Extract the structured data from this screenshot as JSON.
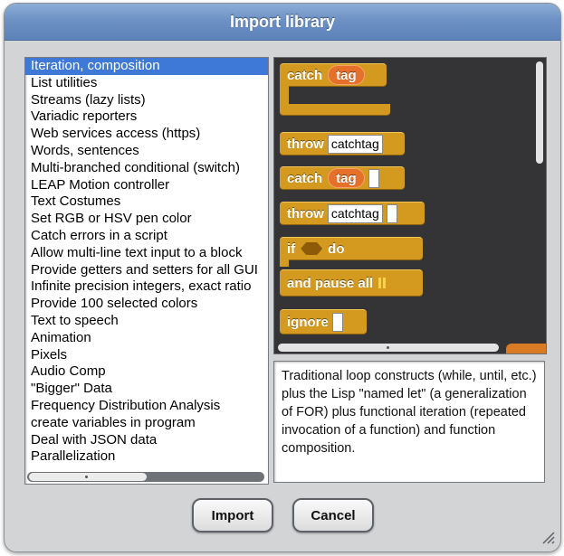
{
  "dialog": {
    "title": "Import library"
  },
  "library_list": {
    "selected_index": 0,
    "items": [
      "Iteration, composition",
      "List utilities",
      "Streams (lazy lists)",
      "Variadic reporters",
      "Web services access (https)",
      "Words, sentences",
      "Multi-branched conditional (switch)",
      "LEAP Motion controller",
      "Text Costumes",
      "Set RGB or HSV pen color",
      "Catch errors in a script",
      "Allow multi-line text input to a block",
      "Provide getters and setters for all GUI",
      "Infinite precision integers, exact ratio",
      "Provide 100 selected colors",
      "Text to speech",
      "Animation",
      "Pixels",
      "Audio Comp",
      "\"Bigger\" Data",
      "Frequency Distribution Analysis",
      "create variables in program",
      "Deal with JSON data",
      "Parallelization"
    ]
  },
  "preview": {
    "blocks": {
      "catch1": {
        "label": "catch",
        "var": "tag"
      },
      "throw1": {
        "label": "throw",
        "slot": "catchtag"
      },
      "catch2": {
        "label": "catch",
        "var": "tag"
      },
      "throw2": {
        "label": "throw",
        "slot": "catchtag"
      },
      "ifdo": {
        "if_label": "if",
        "do_label": "do"
      },
      "pause": {
        "label": "and pause all"
      },
      "ignore": {
        "label": "ignore"
      }
    }
  },
  "description": "Traditional loop constructs (while, until, etc.) plus the Lisp \"named let\" (a generalization of FOR) plus functional iteration (repeated invocation of a function) and function composition.",
  "buttons": {
    "import": "Import",
    "cancel": "Cancel"
  },
  "colors": {
    "titlebar": "#6d91c4",
    "selection": "#3f79d8",
    "control_block": "#d49a1f",
    "variable": "#e6702a"
  }
}
